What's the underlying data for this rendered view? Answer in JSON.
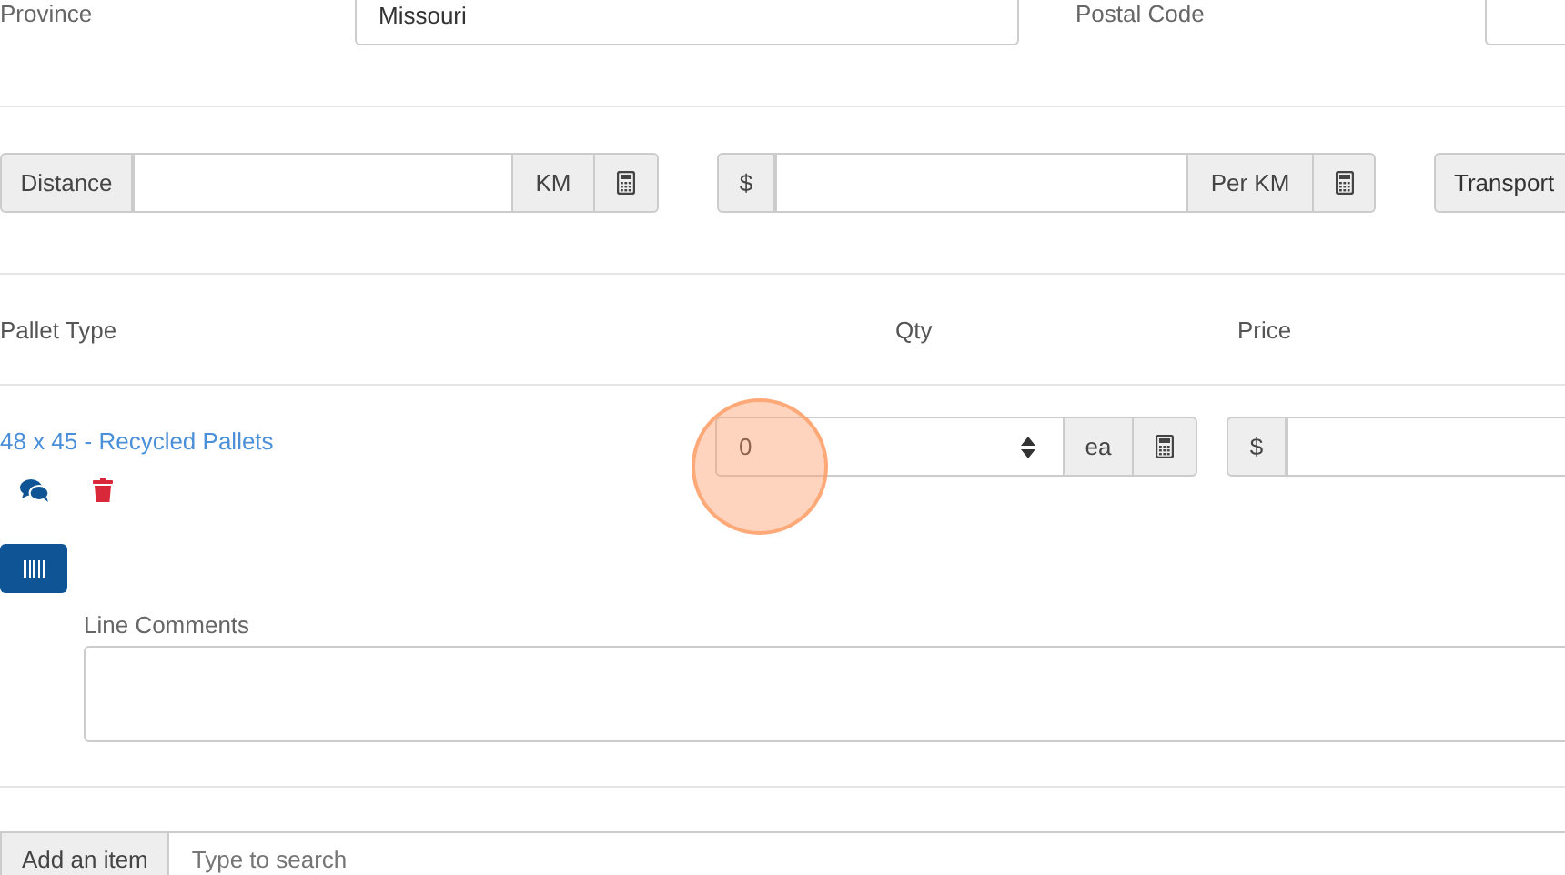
{
  "address": {
    "province_label": "Province",
    "province_value": "Missouri",
    "postal_code_label": "Postal Code"
  },
  "transport": {
    "distance_label": "Distance",
    "distance_unit": "KM",
    "rate_prefix": "$",
    "rate_unit": "Per KM",
    "transport_button": "Transport"
  },
  "columns": [
    "Pallet Type",
    "Qty",
    "Price"
  ],
  "items": [
    {
      "name": "48 x 45 - Recycled Pallets",
      "qty": "0",
      "qty_unit": "ea",
      "price_prefix": "$",
      "comments_label": "Line Comments"
    }
  ],
  "add_item": {
    "label": "Add an item",
    "placeholder": "Type to search"
  }
}
